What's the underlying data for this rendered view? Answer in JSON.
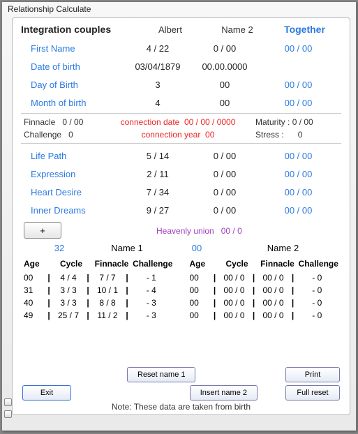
{
  "window": {
    "title": "Relationship Calculate"
  },
  "header": {
    "integration": "Integration couples",
    "name1": "Albert",
    "name2": "Name 2",
    "together": "Together"
  },
  "rows": {
    "first_name": {
      "label": "First Name",
      "c1": "4  /  22",
      "c2": "0  /  00",
      "c3": "00  /  00"
    },
    "dob": {
      "label": "Date of birth",
      "c1": "03/04/1879",
      "c2": "00.00.0000",
      "c3": ""
    },
    "day": {
      "label": "Day of Birth",
      "c1": "3",
      "c2": "00",
      "c3": "00  /  00"
    },
    "month": {
      "label": "Month of birth",
      "c1": "4",
      "c2": "00",
      "c3": "00  /  00"
    },
    "life_path": {
      "label": "Life Path",
      "c1": "5  /  14",
      "c2": "0  /  00",
      "c3": "00  /  00"
    },
    "expression": {
      "label": "Expression",
      "c1": "2  /  11",
      "c2": "0  /  00",
      "c3": "00  /  00"
    },
    "heart": {
      "label": "Heart Desire",
      "c1": "7  /  34",
      "c2": "0  /  00",
      "c3": "00  /  00"
    },
    "inner": {
      "label": "Inner Dreams",
      "c1": "9  /  27",
      "c2": "0  /  00",
      "c3": "00  /  00"
    }
  },
  "conn": {
    "finnacle_lbl": "Finnacle",
    "finnacle_v": "0 / 00",
    "challenge_lbl": "Challenge",
    "challenge_v": "0",
    "date_lbl": "connection date",
    "date_v": "00 / 00 / 0000",
    "year_lbl": "connection year",
    "year_v": "00",
    "mat_lbl": "Maturity :",
    "mat_v": "0 / 00",
    "stress_lbl": "Stress :",
    "stress_v": "0"
  },
  "plus": "+",
  "heavenly": {
    "lbl": "Heavenly union",
    "v": "00  /  0"
  },
  "nameline": {
    "n1num": "32",
    "n1lbl": "Name 1",
    "n2num": "00",
    "n2lbl": "Name 2"
  },
  "tblhdr": {
    "age": "Age",
    "cycle": "Cycle",
    "finn": "Finnacle",
    "chal": "Challenge"
  },
  "tbl1": [
    {
      "age": "00",
      "cycle": "4  /  4",
      "finn": "7  /  7",
      "chal": "-  1"
    },
    {
      "age": "31",
      "cycle": "3  /  3",
      "finn": "10  /  1",
      "chal": "-  4"
    },
    {
      "age": "40",
      "cycle": "3  /  3",
      "finn": "8  /  8",
      "chal": "-  3"
    },
    {
      "age": "49",
      "cycle": "25  /  7",
      "finn": "11  /  2",
      "chal": "-  3"
    }
  ],
  "tbl2": [
    {
      "age": "00",
      "cycle": "00  /  0",
      "finn": "00  /  0",
      "chal": "-  0"
    },
    {
      "age": "00",
      "cycle": "00  /  0",
      "finn": "00  /  0",
      "chal": "-  0"
    },
    {
      "age": "00",
      "cycle": "00  /  0",
      "finn": "00  /  0",
      "chal": "-  0"
    },
    {
      "age": "00",
      "cycle": "00  /  0",
      "finn": "00  /  0",
      "chal": "-  0"
    }
  ],
  "buttons": {
    "reset1": "Reset name 1",
    "insert2": "Insert name 2",
    "print": "Print",
    "fullreset": "Full reset",
    "exit": "Exit"
  },
  "note": "Note: These data are taken from birth"
}
